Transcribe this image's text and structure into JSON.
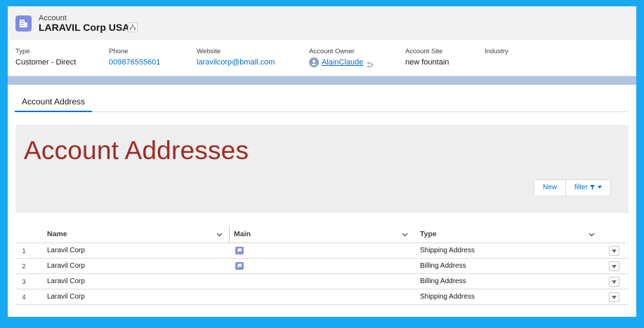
{
  "header": {
    "object_label": "Account",
    "record_title": "LARAVIL Corp USA",
    "fields": [
      {
        "label": "Type",
        "value": "Customer - Direct"
      },
      {
        "label": "Phone",
        "value": "009876555601"
      },
      {
        "label": "Website",
        "value": "laravilcorp@bmall.com"
      },
      {
        "label": "Account Owner",
        "value": "AlainClaude"
      },
      {
        "label": "Account Site",
        "value": "new fountain"
      },
      {
        "label": "Industry",
        "value": ""
      }
    ]
  },
  "tabs": [
    {
      "label": "Account Address"
    }
  ],
  "panel": {
    "title": "Account Addresses",
    "new_label": "New",
    "filter_label": "filter"
  },
  "table": {
    "columns": [
      {
        "label": "Name"
      },
      {
        "label": "Main"
      },
      {
        "label": "Type"
      }
    ],
    "rows": [
      {
        "num": "1",
        "name": "Laravil Corp",
        "main": true,
        "type": "Shipping Address"
      },
      {
        "num": "2",
        "name": "Laravil Corp",
        "main": true,
        "type": "Billing Address"
      },
      {
        "num": "3",
        "name": "Laravil Corp",
        "main": false,
        "type": "Billing Address"
      },
      {
        "num": "4",
        "name": "Laravil Corp",
        "main": false,
        "type": "Shipping Address"
      }
    ]
  },
  "colors": {
    "accent": "#0070d2",
    "title_red": "#9e2b25",
    "account_icon": "#7f8de1",
    "frame": "#18a9f2"
  },
  "icons": {
    "account": "building-icon",
    "hierarchy": "hierarchy-icon",
    "owner_avatar": "user-avatar-icon",
    "change_owner": "change-owner-icon",
    "main_flag": "flag-icon",
    "row_action": "chevron-down-icon"
  }
}
